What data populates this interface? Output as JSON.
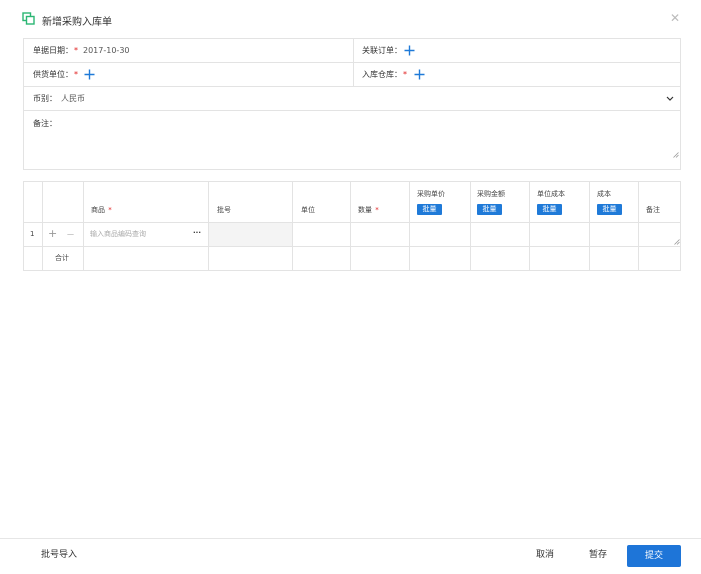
{
  "dialog": {
    "title": "新增采购入库单",
    "close_icon": "close-icon",
    "app_icon": "copy-icon",
    "accent_color": "#1f7ad8"
  },
  "form": {
    "doc_date_label": "单据日期：",
    "doc_date_value": "2017-10-30",
    "related_order_label": "关联订单：",
    "supplier_label": "供货单位：",
    "warehouse_label": "入库仓库：",
    "currency_label": "币别：",
    "currency_value": "人民币",
    "remark_label": "备注：",
    "required_mark": "*"
  },
  "table": {
    "columns": {
      "product": "商品",
      "batch_no": "批号",
      "unit": "单位",
      "quantity": "数量",
      "purchase_price": "采购单价",
      "purchase_amount": "采购金额",
      "unit_cost": "单位成本",
      "cost": "成本",
      "remark": "备注"
    },
    "batch_button": "批量",
    "rows": [
      {
        "index": "1",
        "add": "+",
        "remove": "—",
        "product_placeholder": "输入商品编码查询",
        "more": "···"
      }
    ],
    "total_label": "合计"
  },
  "footer": {
    "batch_import": "批号导入",
    "cancel": "取消",
    "save_draft": "暂存",
    "submit": "提交"
  }
}
